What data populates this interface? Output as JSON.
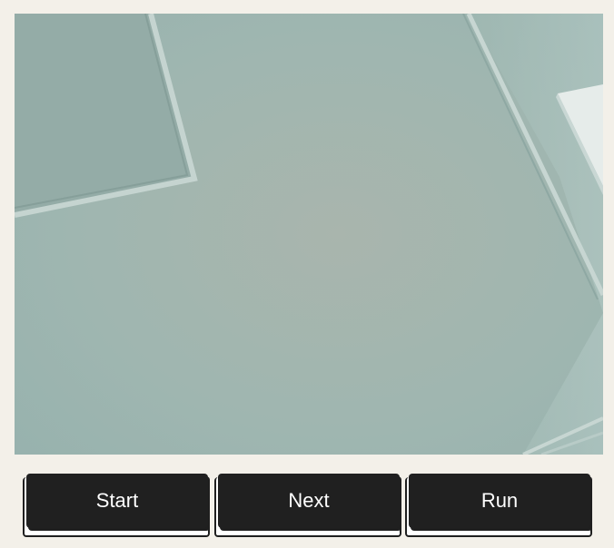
{
  "camera": {
    "scene": "ceiling-view"
  },
  "buttons": {
    "start_label": "Start",
    "next_label": "Next",
    "run_label": "Run"
  },
  "colors": {
    "background": "#f3f0e9",
    "button": "#202020",
    "button_text": "#ffffff",
    "preview_wall": "#a3b9b4"
  }
}
